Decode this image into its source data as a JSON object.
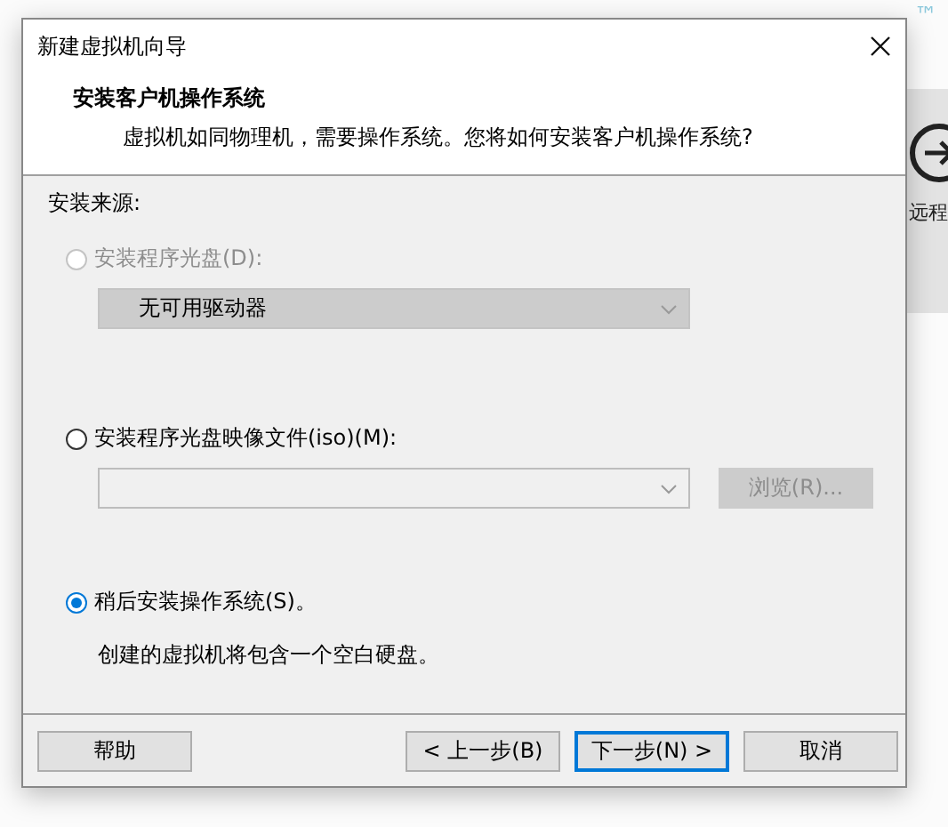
{
  "background": {
    "brand_mark": "™",
    "side_panel_label": "远程"
  },
  "dialog": {
    "title": "新建虚拟机向导",
    "header": {
      "title": "安装客户机操作系统",
      "subtitle": "虚拟机如同物理机，需要操作系统。您将如何安装客户机操作系统?"
    },
    "section_label": "安装来源:",
    "options": [
      {
        "kind": "disc",
        "label": "安装程序光盘(D):",
        "selected": false,
        "disabled": true,
        "dropdown": {
          "value": "无可用驱动器",
          "disabled": true
        }
      },
      {
        "kind": "iso",
        "label": "安装程序光盘映像文件(iso)(M):",
        "selected": false,
        "disabled": false,
        "browse_button": {
          "label": "浏览(R)...",
          "disabled": true
        }
      },
      {
        "kind": "later",
        "label": "稍后安装操作系统(S)。",
        "selected": true,
        "disabled": false,
        "note": "创建的虚拟机将包含一个空白硬盘。"
      }
    ],
    "buttons": [
      {
        "label": "帮助",
        "focused": false
      },
      {
        "label": "< 上一步(B)",
        "focused": false
      },
      {
        "label": "下一步(N) >",
        "focused": true
      },
      {
        "label": "取消",
        "focused": false
      }
    ]
  }
}
